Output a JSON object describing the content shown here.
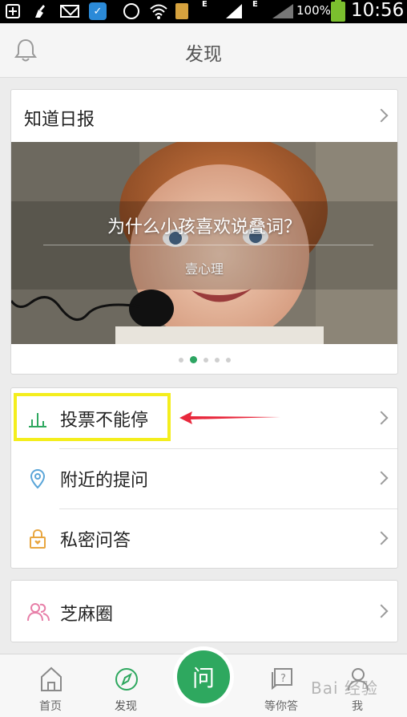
{
  "status_bar": {
    "battery_percent": "100%",
    "time": "10:56",
    "network_type": "E",
    "network_type_2": "E"
  },
  "header": {
    "title": "发现"
  },
  "daily_card": {
    "title": "知道日报",
    "banner": {
      "title": "为什么小孩喜欢说叠词？",
      "subtitle": "壹心理",
      "page_count": 5,
      "active_page": 2
    }
  },
  "menu": {
    "items": [
      {
        "label": "投票不能停",
        "icon": "bar-chart-icon"
      },
      {
        "label": "附近的提问",
        "icon": "location-pin-icon"
      },
      {
        "label": "私密问答",
        "icon": "lock-icon"
      }
    ]
  },
  "zhima": {
    "label": "芝麻圈",
    "icon": "people-icon"
  },
  "tabbar": {
    "home": "首页",
    "discover": "发现",
    "ask": "问",
    "wait_answer": "等你答",
    "me": "我"
  },
  "watermark": "Bai 经验",
  "colors": {
    "accent_green": "#2ea85f",
    "highlight_yellow": "#f4ee1d",
    "arrow_red": "#e8283c"
  }
}
